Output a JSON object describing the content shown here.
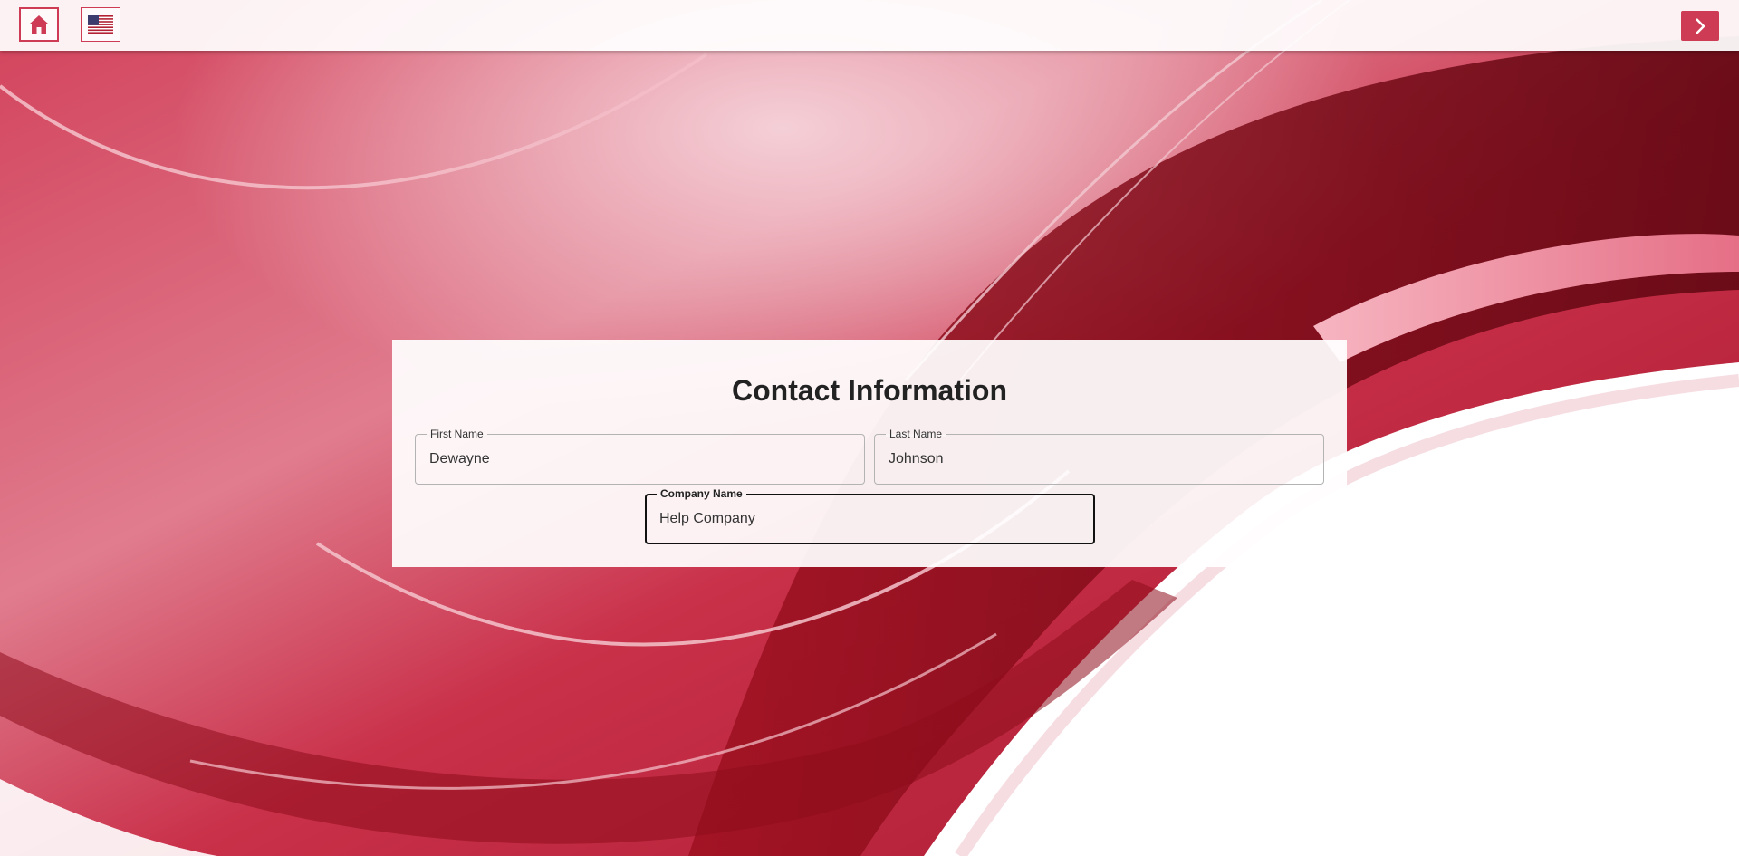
{
  "topbar": {
    "home_icon": "home-icon",
    "language_icon": "us-flag-icon",
    "next_icon": "chevron-right-icon"
  },
  "form": {
    "title": "Contact Information",
    "first_name": {
      "label": "First Name",
      "value": "Dewayne"
    },
    "last_name": {
      "label": "Last Name",
      "value": "Johnson"
    },
    "company_name": {
      "label": "Company Name",
      "value": "Help Company"
    }
  },
  "colors": {
    "accent": "#cd3b54",
    "background_red": "#c8283f",
    "dark_red": "#7a0a14",
    "focus_border": "#111111"
  }
}
